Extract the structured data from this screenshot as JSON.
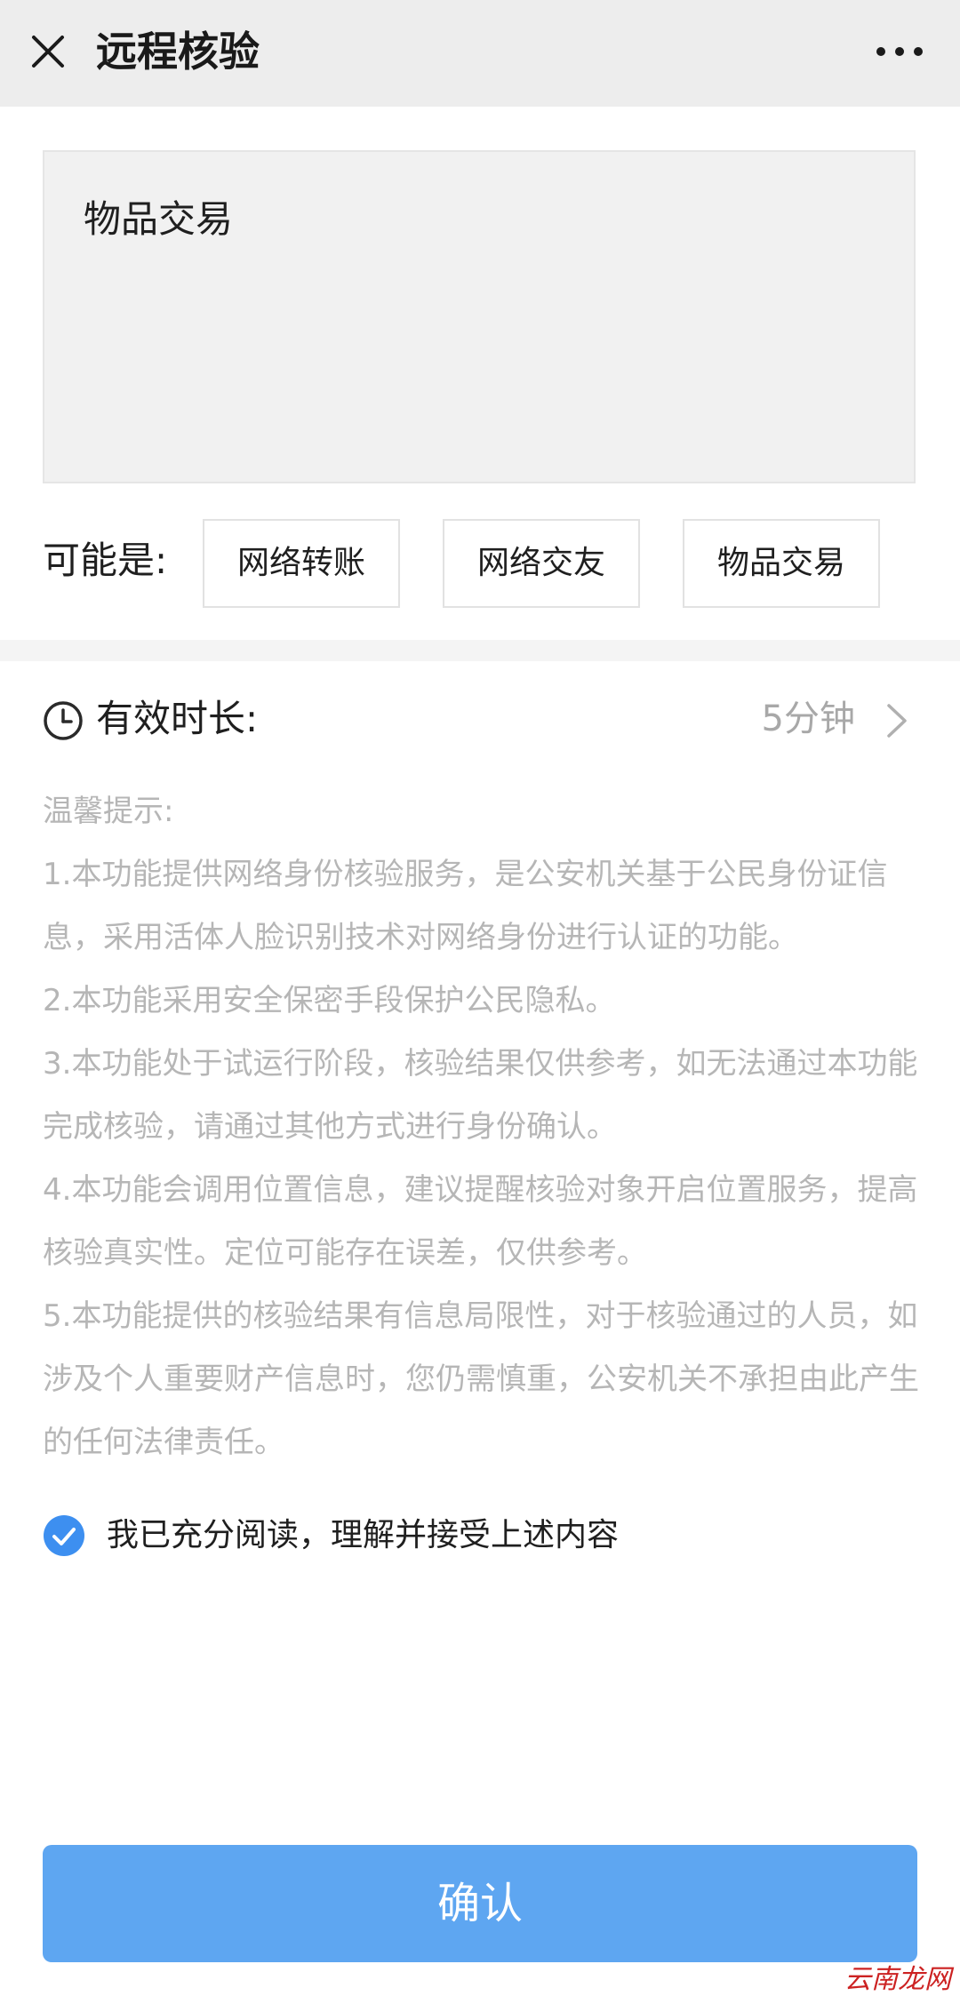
{
  "navbar": {
    "close_icon": "close-icon",
    "title": "远程核验",
    "more_icon": "more-dots-icon"
  },
  "input": {
    "value": "物品交易"
  },
  "suggestions": {
    "label": "可能是:",
    "options": [
      "网络转账",
      "网络交友",
      "物品交易"
    ]
  },
  "duration": {
    "icon": "clock-icon",
    "label": "有效时长:",
    "value": "5分钟",
    "chevron": "chevron-right-icon"
  },
  "tips": {
    "heading": "温馨提示:",
    "items": [
      "1.本功能提供网络身份核验服务，是公安机关基于公民身份证信息，采用活体人脸识别技术对网络身份进行认证的功能。",
      "2.本功能采用安全保密手段保护公民隐私。",
      "3.本功能处于试运行阶段，核验结果仅供参考，如无法通过本功能完成核验，请通过其他方式进行身份确认。",
      "4.本功能会调用位置信息，建议提醒核验对象开启位置服务，提高核验真实性。定位可能存在误差，仅供参考。",
      "5.本功能提供的核验结果有信息局限性，对于核验通过的人员，如涉及个人重要财产信息时，您仍需慎重，公安机关不承担由此产生的任何法律责任。"
    ]
  },
  "agreement": {
    "checked": true,
    "text": "我已充分阅读，理解并接受上述内容"
  },
  "confirm_label": "确认",
  "watermark": "云南龙网",
  "colors": {
    "primary": "#5ea6f1",
    "check": "#3d8ff0",
    "muted_text": "#b6b6b6",
    "navbar_bg": "#ededed"
  }
}
